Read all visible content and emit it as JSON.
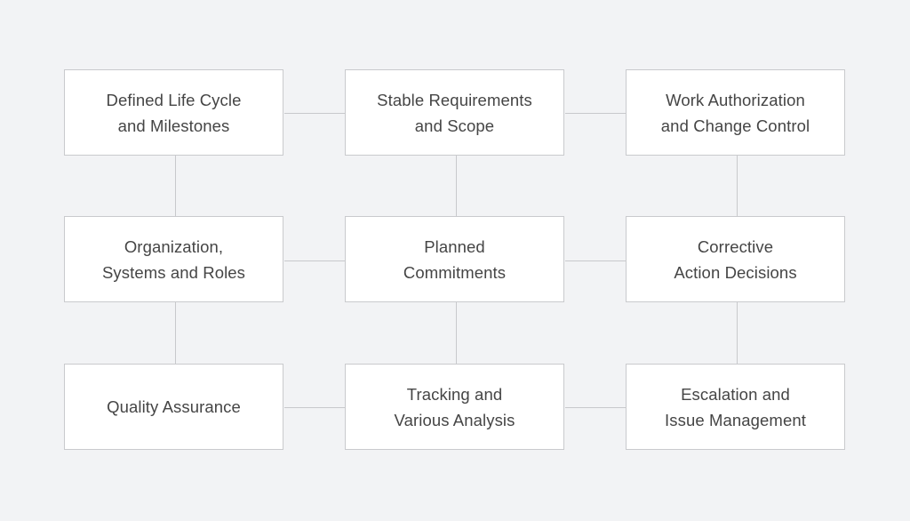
{
  "diagram": {
    "type": "grid-flow",
    "nodes": [
      {
        "id": "n1",
        "label": "Defined Life Cycle\nand Milestones"
      },
      {
        "id": "n2",
        "label": "Stable Requirements\nand Scope"
      },
      {
        "id": "n3",
        "label": "Work Authorization\nand Change Control"
      },
      {
        "id": "n4",
        "label": "Organization,\nSystems and Roles"
      },
      {
        "id": "n5",
        "label": "Planned\nCommitments"
      },
      {
        "id": "n6",
        "label": "Corrective\nAction Decisions"
      },
      {
        "id": "n7",
        "label": "Quality Assurance"
      },
      {
        "id": "n8",
        "label": "Tracking and\nVarious Analysis"
      },
      {
        "id": "n9",
        "label": "Escalation and\nIssue Management"
      }
    ],
    "edges": [
      [
        "n1",
        "n2"
      ],
      [
        "n2",
        "n3"
      ],
      [
        "n4",
        "n5"
      ],
      [
        "n5",
        "n6"
      ],
      [
        "n7",
        "n8"
      ],
      [
        "n8",
        "n9"
      ],
      [
        "n1",
        "n4"
      ],
      [
        "n4",
        "n7"
      ],
      [
        "n2",
        "n5"
      ],
      [
        "n5",
        "n8"
      ],
      [
        "n3",
        "n6"
      ],
      [
        "n6",
        "n9"
      ]
    ],
    "colors": {
      "background": "#f2f3f5",
      "node_fill": "#ffffff",
      "node_border": "#c9cacd",
      "connector": "#c8c9cc",
      "text": "#454545"
    }
  }
}
